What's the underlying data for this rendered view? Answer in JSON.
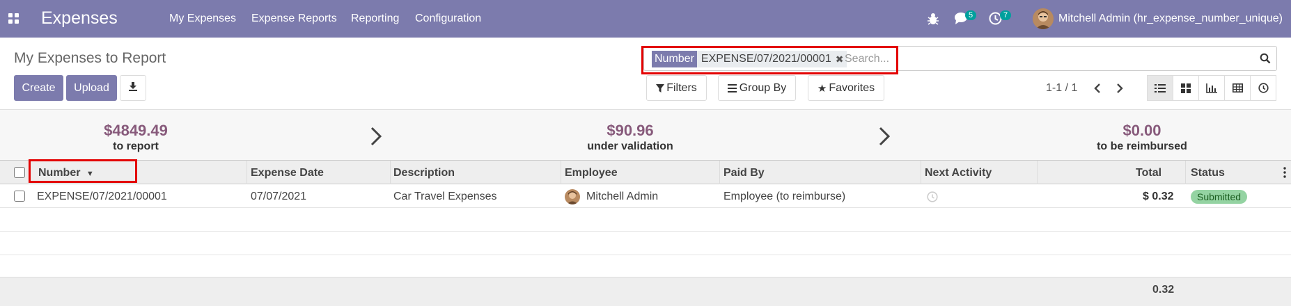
{
  "navbar": {
    "app_name": "Expenses",
    "menu": [
      "My Expenses",
      "Expense Reports",
      "Reporting",
      "Configuration"
    ],
    "messages_count": "5",
    "activities_count": "7",
    "user_name": "Mitchell Admin (hr_expense_number_unique)"
  },
  "control_panel": {
    "title": "My Expenses to Report",
    "create_label": "Create",
    "upload_label": "Upload",
    "search": {
      "facet_type": "Number",
      "facet_value": "EXPENSE/07/2021/00001",
      "placeholder": "Search..."
    },
    "filters_label": "Filters",
    "groupby_label": "Group By",
    "favorites_label": "Favorites",
    "pager": "1-1 / 1"
  },
  "stats": [
    {
      "amount": "$4849.49",
      "label": "to report"
    },
    {
      "amount": "$90.96",
      "label": "under validation"
    },
    {
      "amount": "$0.00",
      "label": "to be reimbursed"
    }
  ],
  "table": {
    "columns": [
      "Number",
      "Expense Date",
      "Description",
      "Employee",
      "Paid By",
      "Next Activity",
      "Total",
      "Status"
    ],
    "rows": [
      {
        "number": "EXPENSE/07/2021/00001",
        "date": "07/07/2021",
        "description": "Car Travel Expenses",
        "employee": "Mitchell Admin",
        "paid_by": "Employee (to reimburse)",
        "total": "$ 0.32",
        "status": "Submitted"
      }
    ],
    "footer_total": "0.32"
  },
  "colors": {
    "brand": "#7c7bad",
    "stat_amount": "#875a7b",
    "highlight": "#e30000",
    "status_submitted": "#94d3a2"
  }
}
